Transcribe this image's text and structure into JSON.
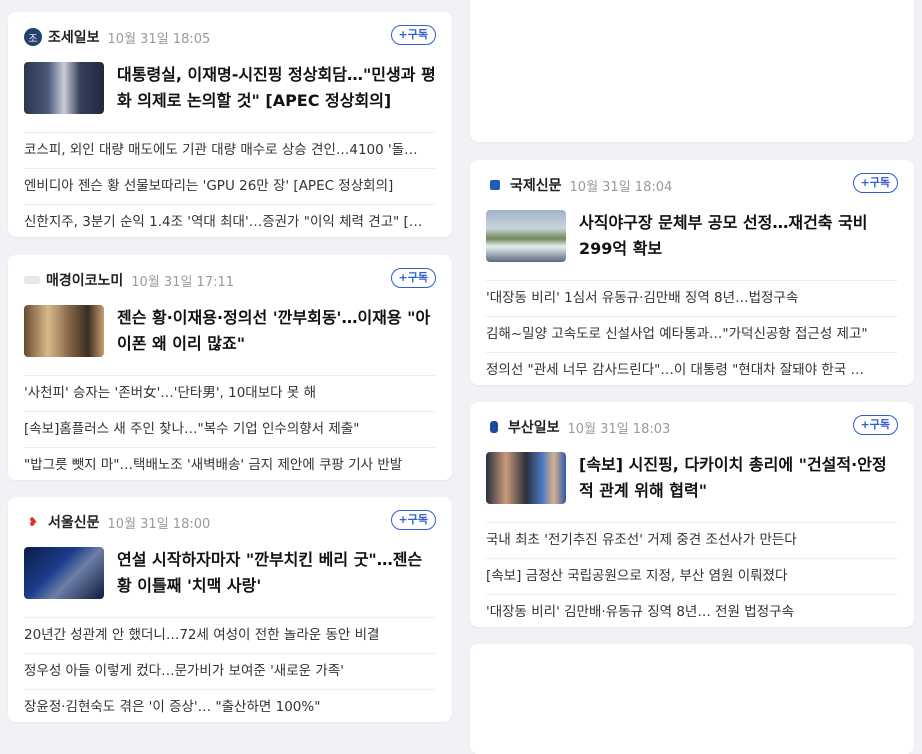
{
  "sub_label": "+구독",
  "cards": [
    {
      "publisher": "조세일보",
      "time": "10월 31일 18:05",
      "headline": "대통령실, 이재명-시진핑 정상회담…\"민생과 평화 의제로 논의할 것\" [APEC 정상회의]",
      "items": [
        "코스피, 외인 대량 매도에도 기관 대량 매수로 상승 견인…4100 '돌…",
        "엔비디아 젠슨 황 선물보따리는 'GPU 26만 장'  [APEC 정상회의]",
        "신한지주, 3분기 순익 1.4조 '역대 최대'…증권가 \"이익 체력 견고\" […"
      ]
    },
    {
      "publisher": "매경이코노미",
      "time": "10월 31일 17:11",
      "headline": "젠슨 황·이재용·정의선 '깐부회동'…이재용 \"아이폰 왜 이리 많죠\"",
      "items": [
        "'사천피' 승자는 '존버女'…'단타男', 10대보다 못 해",
        "[속보]홈플러스 새 주인 찾나…\"복수 기업 인수의향서 제출\"",
        "\"밥그릇 뺏지 마\"…택배노조 '새벽배송' 금지 제안에 쿠팡 기사 반발"
      ]
    },
    {
      "publisher": "서울신문",
      "time": "10월 31일 18:00",
      "headline": "연설 시작하자마자 \"깐부치킨 베리 굿\"…젠슨 황 이틀째 '치맥 사랑'",
      "items": [
        "20년간 성관계 안 했더니…72세 여성이 전한 놀라운 동안 비결",
        "정우성 아들 이렇게 컸다…문가비가 보여준 '새로운 가족'",
        "장윤정·김현숙도 겪은 '이 증상'… \"출산하면 100%\""
      ]
    },
    {
      "publisher": "국제신문",
      "time": "10월 31일 18:04",
      "headline": "사직야구장 문체부 공모 선정…재건축 국비 299억 확보",
      "items": [
        "'대장동 비리' 1심서 유동규·김만배 징역 8년…법정구속",
        "김해~밀양 고속도로 신설사업 예타통과…\"가덕신공항 접근성 제고\"",
        "정의선 \"관세 너무 감사드린다\"…이 대통령 \"현대차 잘돼야 한국 …"
      ]
    },
    {
      "publisher": "부산일보",
      "time": "10월 31일 18:03",
      "headline": "[속보] 시진핑, 다카이치 총리에 \"건설적·안정적 관계 위해 협력\"",
      "items": [
        "국내 최초 '전기추진 유조선' 거제 중견 조선사가 만든다",
        "[속보] 금정산 국립공원으로 지정, 부산 염원 이뤄졌다",
        "'대장동 비리' 김만배·유동규 징역 8년… 전원 법정구속"
      ]
    }
  ]
}
